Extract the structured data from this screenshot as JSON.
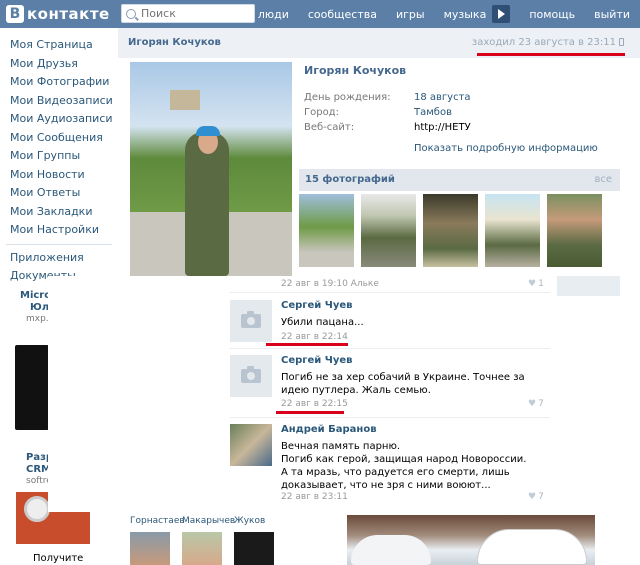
{
  "header": {
    "logo_letter": "В",
    "logo_text": "контакте",
    "search_placeholder": "Поиск",
    "nav": [
      "люди",
      "сообщества",
      "игры",
      "музыка",
      "помощь",
      "выйти"
    ]
  },
  "sidebar": {
    "items": [
      "Моя Страница",
      "Мои Друзья",
      "Мои Фотографии",
      "Мои Видеозаписи",
      "Мои Аудиозаписи",
      "Мои Сообщения",
      "Мои Группы",
      "Мои Новости",
      "Мои Ответы",
      "Мои Закладки",
      "Мои Настройки"
    ],
    "extra": [
      "Приложения",
      "Документы"
    ]
  },
  "ads": {
    "ad1_title_1": "Micro",
    "ad1_title_2": "Юл",
    "ad1_url": "mxp.u",
    "ad2_title_1": "Разр",
    "ad2_title_2": "CRM-",
    "ad2_url": "softre",
    "button": "Получите"
  },
  "profile": {
    "header_name": "Игорян Кочуков",
    "last_seen": "заходил 23 августа в 23:11",
    "name": "Игорян Кочуков",
    "info": [
      {
        "key": "День рождения:",
        "value": "18 августа"
      },
      {
        "key": "Город:",
        "value": "Тамбов"
      },
      {
        "key": "Веб-сайт:",
        "value": "http://НЕТУ"
      }
    ],
    "more_info": "Показать подробную информацию",
    "photos_label": "15 фотографий",
    "photos_all": "все"
  },
  "wall": {
    "post_meta": "22 авг в 19:10 Алькe",
    "post_likes": "1",
    "comments": [
      {
        "name": "Сергей Чуев",
        "text": "Убили пацана...",
        "time": "22 авг в 22:14",
        "likes": ""
      },
      {
        "name": "Сергей Чуев",
        "text": "Погиб не за хер собачий в Украине. Точнее за идею путлера. Жаль семью.",
        "time": "22 авг в 22:15",
        "likes": "7"
      },
      {
        "name": "Андрей Баранов",
        "text": "Вечная память парню.\nПогиб как герой, защищая народ Новороссии.\nА та мразь, что радуется его смерти, лишь доказывает, что не зря с ними воюют...",
        "time": "22 авг в 23:11",
        "likes": "7"
      }
    ]
  },
  "friends": [
    "Горнастаев",
    "Макарычев",
    "Жуков"
  ],
  "colors": {
    "header_bg": "#5b7fa6",
    "link": "#2b587a",
    "accent_red": "#d9001b"
  }
}
